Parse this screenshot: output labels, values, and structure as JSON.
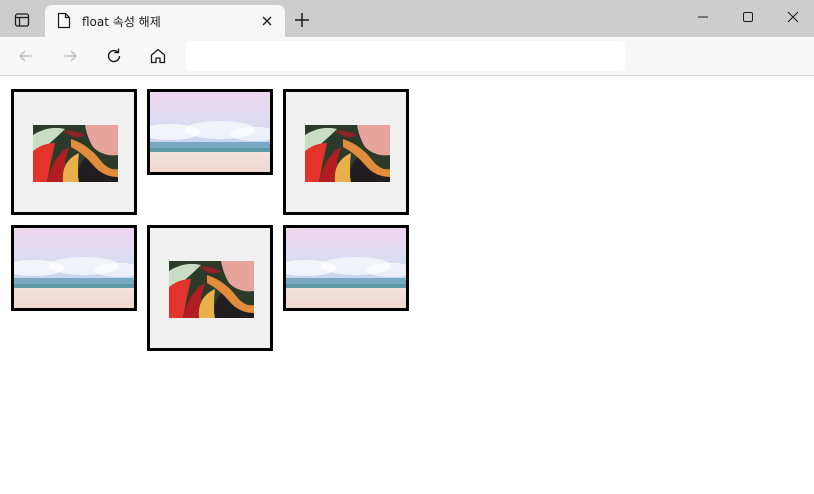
{
  "browser": {
    "tab_title": "float 속성 해제",
    "address_value": "",
    "address_placeholder": ""
  },
  "page": {
    "images": [
      {
        "row": 1,
        "col": 1,
        "kind": "abstract-painting",
        "icon": "abstract-art-image"
      },
      {
        "row": 1,
        "col": 2,
        "kind": "beach-photo",
        "icon": "beach-image"
      },
      {
        "row": 1,
        "col": 3,
        "kind": "abstract-painting",
        "icon": "abstract-art-image"
      },
      {
        "row": 2,
        "col": 1,
        "kind": "beach-photo",
        "icon": "beach-image"
      },
      {
        "row": 2,
        "col": 2,
        "kind": "abstract-painting",
        "icon": "abstract-art-image"
      },
      {
        "row": 2,
        "col": 3,
        "kind": "beach-photo",
        "icon": "beach-image"
      }
    ]
  },
  "colors": {
    "titlebar": "#cdcdcd",
    "toolbar": "#f7f7f7",
    "box_border": "#000000",
    "box_fill": "#f0f0f0"
  }
}
